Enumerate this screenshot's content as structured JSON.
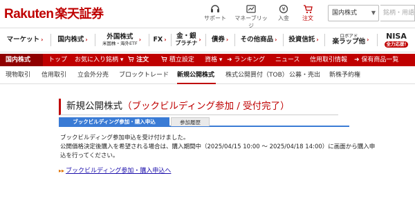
{
  "header": {
    "logo_text": "Rakuten",
    "logo_sub": "楽天証券",
    "icons": [
      {
        "name": "headset-icon",
        "label": "サポート"
      },
      {
        "name": "manage-icon",
        "label": "マネーブリッジ"
      },
      {
        "name": "deposit-icon",
        "label": "入金"
      },
      {
        "name": "cart-icon",
        "label": "注文"
      }
    ],
    "market_select": "国内株式",
    "search_placeholder": "銘柄・用語"
  },
  "main_nav": {
    "items": [
      {
        "label": "マーケット",
        "chevron": "›"
      },
      {
        "label": "国内株式",
        "chevron": "›"
      },
      {
        "label": "外国株式",
        "sub": "米国株・海外ETF",
        "chevron": "›"
      },
      {
        "label": "FX",
        "chevron": "›"
      },
      {
        "label": "金・銀",
        "sub": "プラチナ",
        "chevron": "›"
      },
      {
        "label": "債券",
        "chevron": "›"
      },
      {
        "label": "その他商品",
        "chevron": "›"
      },
      {
        "label": "投資信託",
        "chevron": "›"
      },
      {
        "label": "楽ラップ他",
        "sub_top": "ロボアド",
        "chevron": "›"
      }
    ],
    "nisa_title": "NISA",
    "nisa_badge": "全力応援!"
  },
  "red_bar": {
    "section": "国内株式",
    "items": [
      "トップ",
      "お気に入り銘柄",
      "注文",
      "積立設定",
      "資格",
      "ランキング",
      "ニュース",
      "信用取引情報",
      "保有商品一覧"
    ],
    "caret": "▾",
    "arrow": "➜"
  },
  "sub_nav": {
    "items": [
      "現物取引",
      "信用取引",
      "立会外分売",
      "ブロックトレード",
      "新規公開株式",
      "株式公開買付（TOB）",
      "公募・売出",
      "新株予約権"
    ]
  },
  "page": {
    "title_prefix": "新規公開株式",
    "title_em": "（ブックビルディング参加 / 受付完了）",
    "tabs": {
      "active": "ブックビルディング参加・購入申込",
      "inactive": "参加履歴"
    },
    "message_line1": "ブックビルディング参加申込を受け付けました。",
    "message_line2": "公開価格決定後購入を希望される場合は、購入期間中（2025/04/15 10:00 ～ 2025/04/18 14:00）に画面から購入申",
    "message_line3": "込を行ってください。",
    "link_arrow": "▸▸",
    "link_text": "ブックビルディング参加・購入申込へ"
  },
  "colors": {
    "brand_red": "#bf0000",
    "tab_blue": "#3a7bd5",
    "link_blue": "#1a0dab"
  }
}
